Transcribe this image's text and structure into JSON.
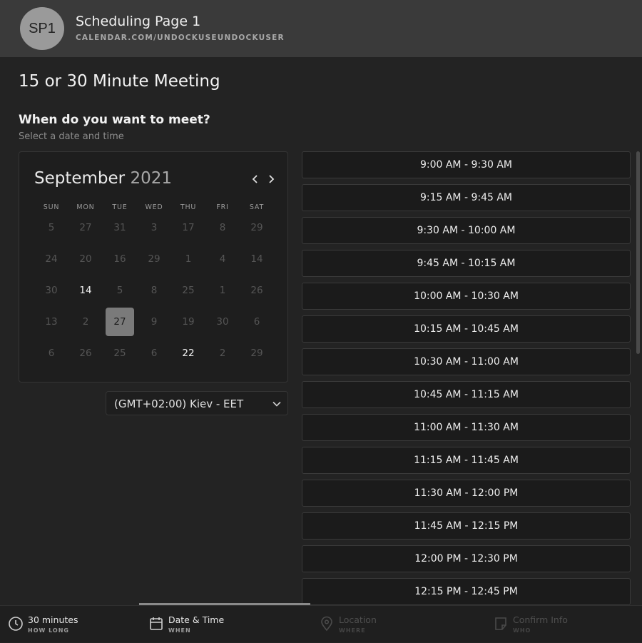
{
  "header": {
    "avatar_initials": "SP1",
    "title": "Scheduling Page 1",
    "url": "CALENDAR.COM/UNDOCKUSEUNDOCKUSER"
  },
  "page_title": "15 or 30 Minute Meeting",
  "section": {
    "title": "When do you want to meet?",
    "subtitle": "Select a date and time"
  },
  "calendar": {
    "month": "September",
    "year": "2021",
    "prev_icon": "chevron-left-icon",
    "next_icon": "chevron-right-icon",
    "weekdays": [
      "SUN",
      "MON",
      "TUE",
      "WED",
      "THU",
      "FRI",
      "SAT"
    ],
    "weeks": [
      [
        {
          "d": "5"
        },
        {
          "d": "27"
        },
        {
          "d": "31"
        },
        {
          "d": "3"
        },
        {
          "d": "17"
        },
        {
          "d": "8"
        },
        {
          "d": "29"
        }
      ],
      [
        {
          "d": "24"
        },
        {
          "d": "20"
        },
        {
          "d": "16"
        },
        {
          "d": "29"
        },
        {
          "d": "1"
        },
        {
          "d": "4"
        },
        {
          "d": "14"
        }
      ],
      [
        {
          "d": "30"
        },
        {
          "d": "14",
          "state": "available"
        },
        {
          "d": "5"
        },
        {
          "d": "8"
        },
        {
          "d": "25"
        },
        {
          "d": "1"
        },
        {
          "d": "26"
        }
      ],
      [
        {
          "d": "13"
        },
        {
          "d": "2"
        },
        {
          "d": "27",
          "state": "selected"
        },
        {
          "d": "9"
        },
        {
          "d": "19"
        },
        {
          "d": "30"
        },
        {
          "d": "6"
        }
      ],
      [
        {
          "d": "6"
        },
        {
          "d": "26"
        },
        {
          "d": "25"
        },
        {
          "d": "6"
        },
        {
          "d": "22",
          "state": "available"
        },
        {
          "d": "2"
        },
        {
          "d": "29"
        }
      ]
    ],
    "selected_bg": "#7a7a7a"
  },
  "timezone": {
    "value": "(GMT+02:00) Kiev - EET",
    "icon": "chevron-down-icon"
  },
  "time_slots": [
    "9:00 AM - 9:30 AM",
    "9:15 AM - 9:45 AM",
    "9:30 AM - 10:00 AM",
    "9:45 AM - 10:15 AM",
    "10:00 AM - 10:30 AM",
    "10:15 AM - 10:45 AM",
    "10:30 AM - 11:00 AM",
    "10:45 AM - 11:15 AM",
    "11:00 AM - 11:30 AM",
    "11:15 AM - 11:45 AM",
    "11:30 AM - 12:00 PM",
    "11:45 AM - 12:15 PM",
    "12:00 PM - 12:30 PM",
    "12:15 PM - 12:45 PM"
  ],
  "footer": {
    "steps": [
      {
        "label": "30 minutes",
        "sub": "HOW LONG",
        "icon": "clock-icon",
        "state": "active"
      },
      {
        "label": "Date & Time",
        "sub": "WHEN",
        "icon": "calendar-icon",
        "state": "active"
      },
      {
        "label": "Location",
        "sub": "WHERE",
        "icon": "location-pin-icon",
        "state": "inactive"
      },
      {
        "label": "Confirm Info",
        "sub": "WHO",
        "icon": "note-icon",
        "state": "inactive"
      }
    ],
    "progress_step": 2,
    "progress_total": 4
  },
  "colors": {
    "background": "#232323",
    "header": "#3a3a3a",
    "slot_border": "#3a3a3a"
  }
}
